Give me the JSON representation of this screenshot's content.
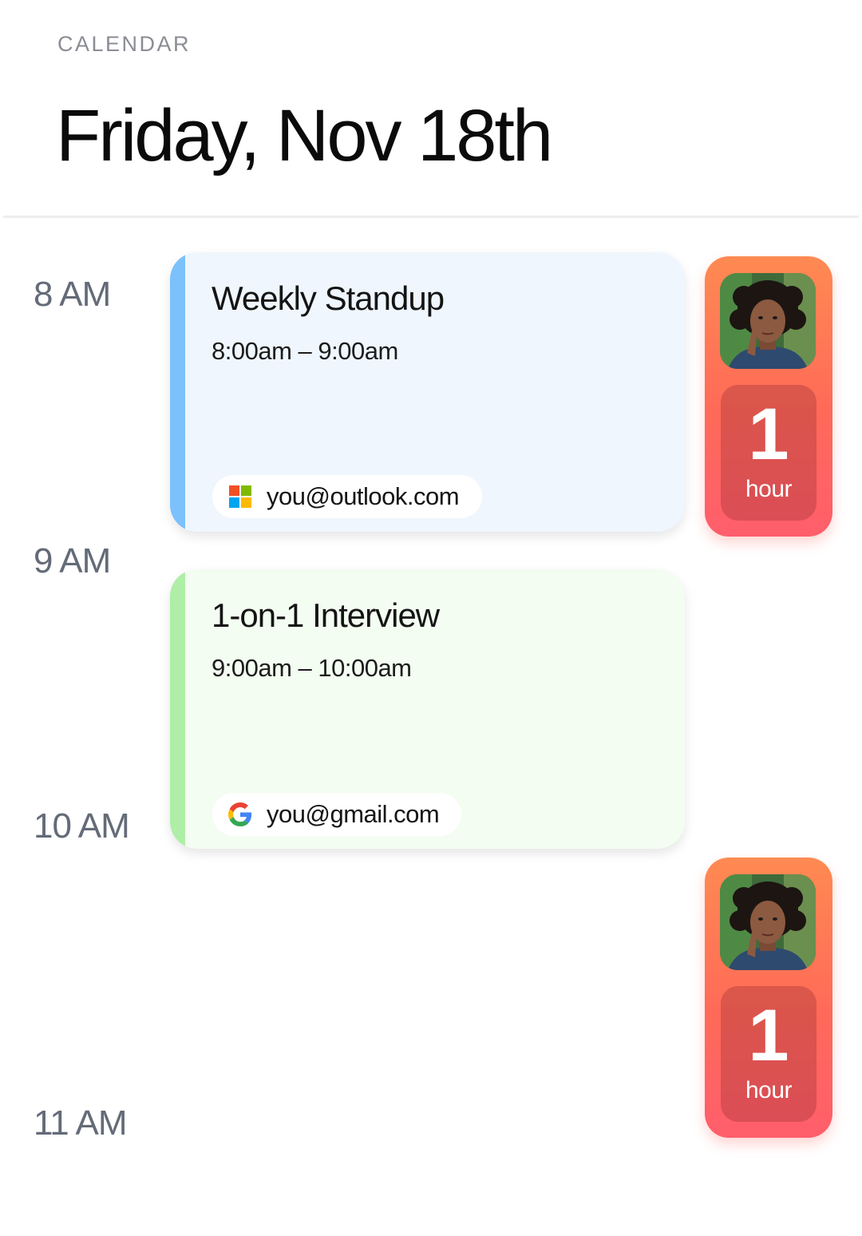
{
  "header": {
    "section_label": "CALENDAR",
    "date_title": "Friday, Nov 18th"
  },
  "timeline": {
    "hours": [
      "8 AM",
      "9 AM",
      "10 AM",
      "11 AM"
    ]
  },
  "events": [
    {
      "title": "Weekly Standup",
      "time_range": "8:00am – 9:00am",
      "account": "you@outlook.com",
      "account_icon": "microsoft-icon",
      "accent_color": "#7cc1fb",
      "background_color": "#eff6fd"
    },
    {
      "title": "1-on-1 Interview",
      "time_range": "9:00am – 10:00am",
      "account": "you@gmail.com",
      "account_icon": "google-icon",
      "accent_color": "#aeeea6",
      "background_color": "#f3fdf1"
    }
  ],
  "duration_widgets": [
    {
      "value": "1",
      "unit": "hour",
      "avatar": "person-avatar"
    },
    {
      "value": "1",
      "unit": "hour",
      "avatar": "person-avatar"
    }
  ],
  "colors": {
    "widget_gradient_top": "#ff8a52",
    "widget_gradient_bottom": "#ff5e6c",
    "time_label": "#646b78"
  }
}
